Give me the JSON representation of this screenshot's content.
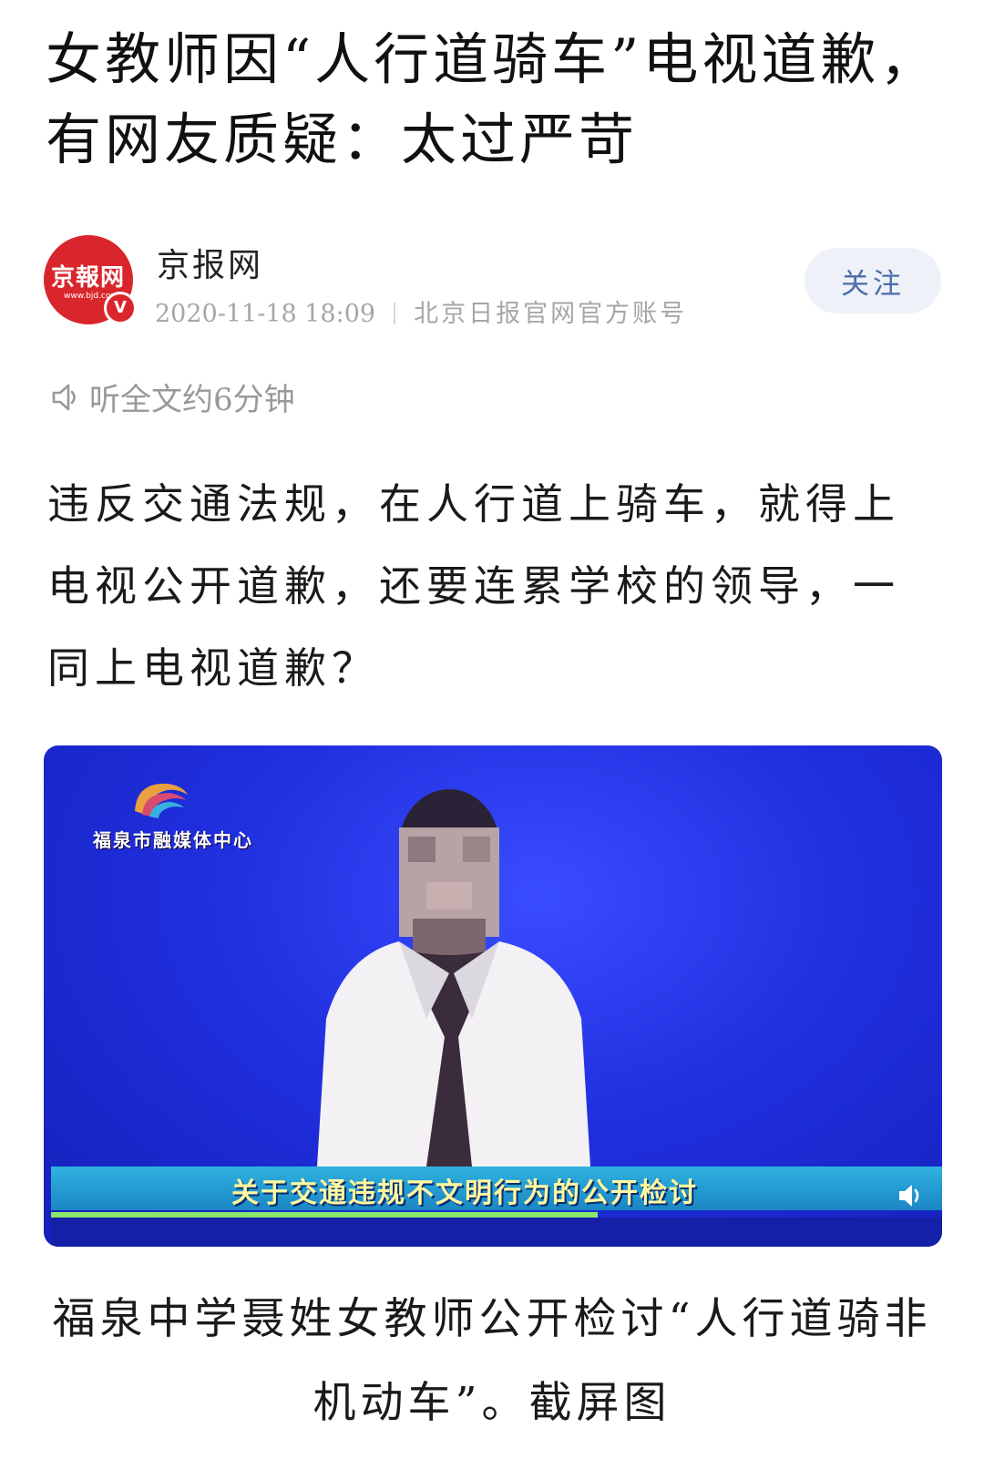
{
  "article": {
    "title": "女教师因“人行道骑车”电视道歉，有网友质疑：太过严苛",
    "body": "违反交通法规，在人行道上骑车，就得上电视公开道歉，还要连累学校的领导，一同上电视道歉？",
    "listen_label": "听全文约6分钟"
  },
  "author": {
    "avatar_text": "京報网",
    "avatar_sub": "www.bjd.com",
    "verified_mark": "V",
    "name": "京报网",
    "publish_time": "2020-11-18 18:09",
    "description": "北京日报官网官方账号",
    "follow_label": "关注"
  },
  "video": {
    "station_name": "福泉市融媒体中心",
    "ticker_text": "关于交通违规不文明行为的公开检讨"
  },
  "caption": "福泉中学聂姓女教师公开检讨“人行道骑非机动车”。截屏图",
  "colors": {
    "brand_red": "#d9262c",
    "follow_text": "#4a6ea8",
    "video_bg": "#2030e0"
  }
}
